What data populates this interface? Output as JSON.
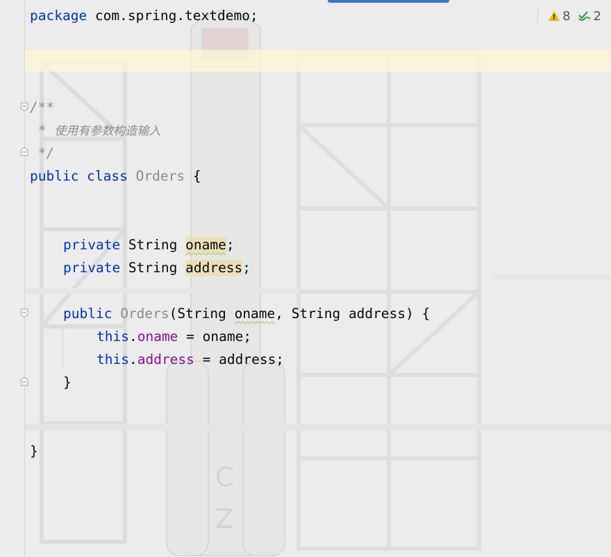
{
  "editor": {
    "inspections": {
      "warnings_count": "8",
      "typos_count": "2",
      "warning_color": "#e6b800",
      "ok_color": "#4b9c50"
    },
    "lines": {
      "package_kw": "package",
      "package_name": " com.spring.textdemo;",
      "doc_open": "/**",
      "doc_star": " * ",
      "doc_text": "使用有参数构造输入",
      "doc_close": " */",
      "class_kw": "public class",
      "class_name": "Orders",
      "class_brace": " {",
      "field1_mod": "private",
      "field1_type": " String ",
      "field1_name": "oname",
      "field1_semi": ";",
      "field2_mod": "private",
      "field2_type": " String ",
      "field2_name": "address",
      "field2_semi": ";",
      "ctor_mod": "public",
      "ctor_name": "Orders",
      "ctor_open": "(String ",
      "ctor_p1": "oname",
      "ctor_mid": ", String address) {",
      "assign1_this": "this",
      "assign1_dot": ".",
      "assign1_field": "oname",
      "assign1_rest": " = oname;",
      "assign2_this": "this",
      "assign2_dot": ".",
      "assign2_field": "address",
      "assign2_rest": " = address;",
      "ctor_close": "}",
      "class_close": "}"
    }
  }
}
